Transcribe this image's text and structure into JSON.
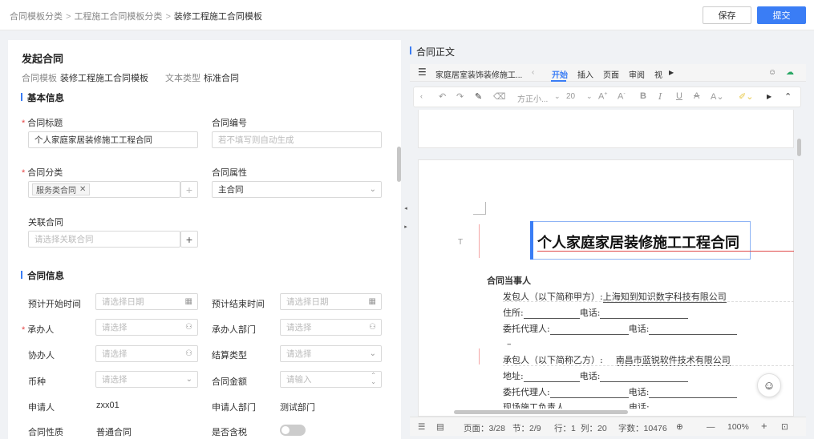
{
  "breadcrumb": {
    "items": [
      "合同模板分类",
      "工程施工合同模板分类"
    ],
    "current": "装修工程施工合同模板",
    "sep": ">"
  },
  "actions": {
    "save": "保存",
    "submit": "提交"
  },
  "form": {
    "title": "发起合同",
    "meta": {
      "template_label": "合同模板",
      "template_value": "装修工程施工合同模板",
      "text_type_label": "文本类型",
      "text_type_value": "标准合同"
    },
    "basic": {
      "heading": "基本信息",
      "contract_title_label": "合同标题",
      "contract_title_value": "个人家庭家居装修施工工程合同",
      "contract_no_label": "合同编号",
      "contract_no_placeholder": "若不填写则自动生成",
      "category_label": "合同分类",
      "category_tag": "服务类合同",
      "attribute_label": "合同属性",
      "attribute_value": "主合同",
      "related_label": "关联合同",
      "related_placeholder": "请选择关联合同"
    },
    "info": {
      "heading": "合同信息",
      "start_label": "预计开始时间",
      "start_placeholder": "请选择日期",
      "end_label": "预计结束时间",
      "end_placeholder": "请选择日期",
      "handler_label": "承办人",
      "handler_placeholder": "请选择",
      "handler_dept_label": "承办人部门",
      "handler_dept_placeholder": "请选择",
      "co_label": "协办人",
      "co_placeholder": "请选择",
      "settle_label": "结算类型",
      "settle_placeholder": "请选择",
      "currency_label": "币种",
      "currency_placeholder": "请选择",
      "amount_label": "合同金额",
      "amount_placeholder": "请输入",
      "applicant_label": "申请人",
      "applicant_value": "zxx01",
      "applicant_dept_label": "申请人部门",
      "applicant_dept_value": "测试部门",
      "nature_label": "合同性质",
      "nature_value": "普通合同",
      "tax_label": "是否含税",
      "tax_on": false
    }
  },
  "doc": {
    "heading": "合同正文",
    "filename": "家庭居室装饰装修施工...",
    "tabs": [
      "开始",
      "插入",
      "页面",
      "审阅",
      "视"
    ],
    "font_name": "方正小...",
    "font_size": "20",
    "title": "个人家庭家居装修施工工程合同",
    "parties_heading": "合同当事人",
    "party_a_label": "发包人（以下简称甲方）:",
    "party_a_value": "上海知到知识数字科技有限公司",
    "addr_label": "住所:",
    "tel_label": "电话:",
    "agent_label": "委托代理人:",
    "dash": "–",
    "party_b_label": "承包人（以下简称乙方）:",
    "party_b_value": "南昌市蓝锐软件技术有限公司",
    "addr2_label": "地址:",
    "site_label": "现场施工负责人"
  },
  "status": {
    "page": "页面：3/28",
    "section": "节：2/9",
    "row": "行：1",
    "col": "列：20",
    "words": "字数：10476",
    "zoom": "100%"
  }
}
